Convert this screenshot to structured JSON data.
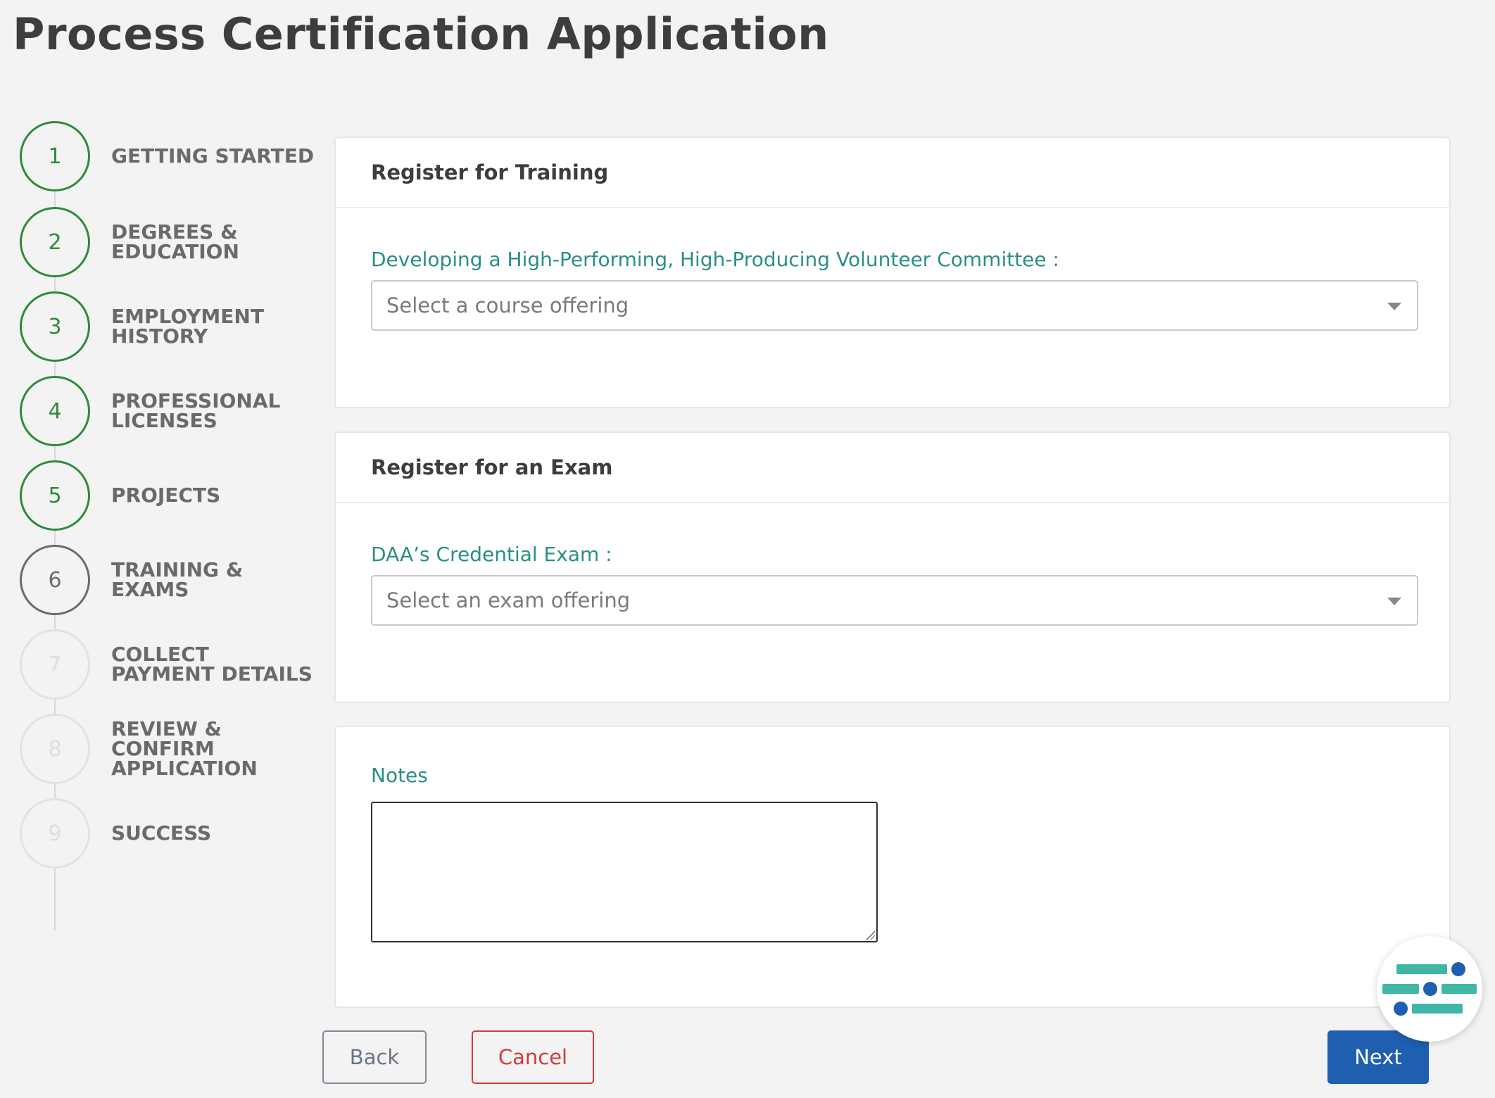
{
  "page": {
    "title": "Process Certification Application"
  },
  "stepper": {
    "steps": [
      {
        "number": "1",
        "label": "GETTING STARTED",
        "state": "done"
      },
      {
        "number": "2",
        "label": "DEGREES & EDUCATION",
        "state": "done"
      },
      {
        "number": "3",
        "label": "EMPLOYMENT HISTORY",
        "state": "done"
      },
      {
        "number": "4",
        "label": "PROFESSIONAL LICENSES",
        "state": "done"
      },
      {
        "number": "5",
        "label": "PROJECTS",
        "state": "done"
      },
      {
        "number": "6",
        "label": "TRAINING & EXAMS",
        "state": "current"
      },
      {
        "number": "7",
        "label": "COLLECT PAYMENT DETAILS",
        "state": "future"
      },
      {
        "number": "8",
        "label": "REVIEW & CONFIRM APPLICATION",
        "state": "future"
      },
      {
        "number": "9",
        "label": "SUCCESS",
        "state": "future"
      }
    ]
  },
  "training": {
    "header": "Register for Training",
    "course_label": "Developing a High-Performing, High-Producing Volunteer Committee :",
    "course_placeholder": "Select a course offering"
  },
  "exam": {
    "header": "Register for an Exam",
    "exam_label": "DAA’s Credential Exam :",
    "exam_placeholder": "Select an exam offering"
  },
  "notes": {
    "label": "Notes",
    "value": ""
  },
  "actions": {
    "back_label": "Back",
    "cancel_label": "Cancel",
    "next_label": "Next"
  },
  "colors": {
    "done": "#2e8b3a",
    "current": "#6b6b6b",
    "future": "#e2e2e2",
    "field_label": "#2a8f86",
    "primary": "#1f5fb0",
    "danger": "#d33b3b",
    "widget_teal": "#3fb7a7",
    "widget_blue": "#1f5fb0"
  },
  "widget": {
    "icon": "assistant-widget-icon"
  }
}
